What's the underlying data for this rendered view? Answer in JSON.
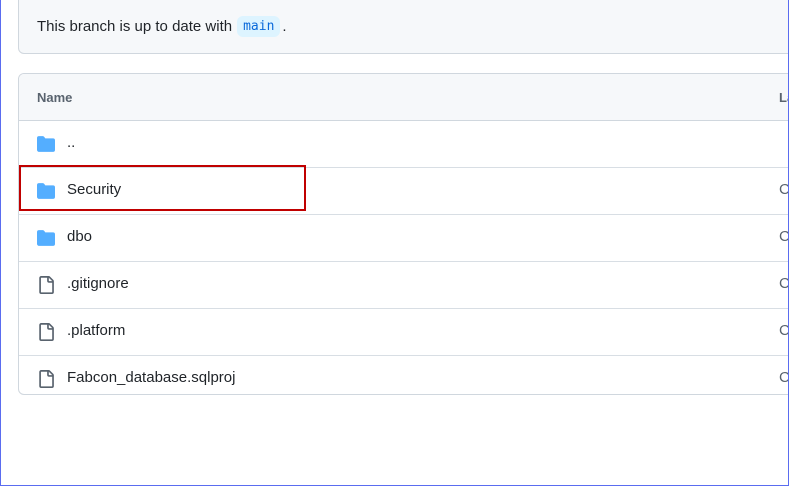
{
  "banner": {
    "text": "This branch is up to date with",
    "branch": "main",
    "period": "."
  },
  "table": {
    "header_name": "Name",
    "header_last_truncated": "La",
    "rows": [
      {
        "name": "..",
        "icon": "folder-icon",
        "truncated": ""
      },
      {
        "name": "Security",
        "icon": "folder-icon",
        "truncated": "C"
      },
      {
        "name": "dbo",
        "icon": "folder-icon",
        "truncated": "C"
      },
      {
        "name": ".gitignore",
        "icon": "file-icon",
        "truncated": "C"
      },
      {
        "name": ".platform",
        "icon": "file-icon",
        "truncated": "C"
      },
      {
        "name": "Fabcon_database.sqlproj",
        "icon": "file-icon",
        "truncated": "C"
      }
    ]
  },
  "colors": {
    "folder": "#54aeff",
    "file_icon": "#59636e",
    "highlight": "#c00000",
    "branch_text": "#0969da",
    "branch_bg": "#ddf4ff"
  }
}
